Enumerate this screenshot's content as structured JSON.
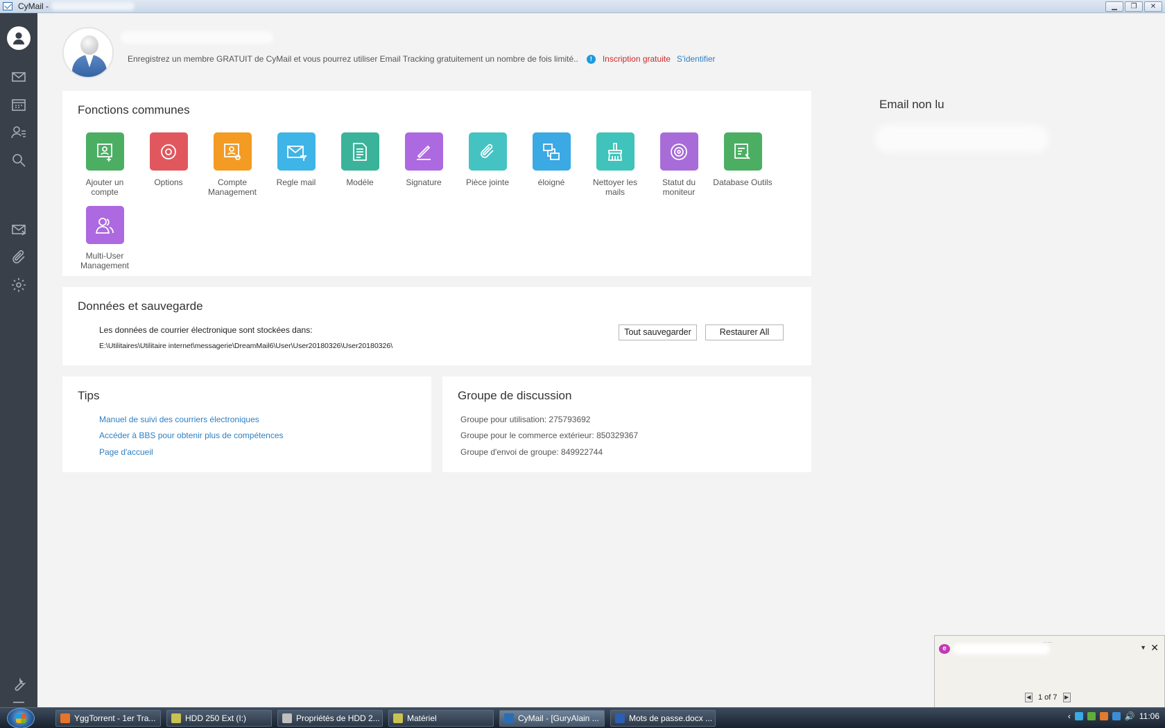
{
  "window": {
    "title": "CyMail - "
  },
  "header": {
    "promo_text": "Enregistrez un membre GRATUIT de CyMail et vous pourrez utiliser Email Tracking gratuitement un nombre de fois limité..",
    "register_link": "Inscription gratuite",
    "login_link": "S'identifier"
  },
  "fonctions": {
    "title": "Fonctions communes",
    "items": [
      {
        "label": "Ajouter un compte",
        "color": "#4cae63",
        "icon": "add-account-icon"
      },
      {
        "label": "Options",
        "color": "#e0585e",
        "icon": "gear-icon"
      },
      {
        "label": "Compte Management",
        "color": "#f39b23",
        "icon": "account-settings-icon"
      },
      {
        "label": "Regle mail",
        "color": "#3fb4e6",
        "icon": "mail-filter-icon"
      },
      {
        "label": "Modéle",
        "color": "#3bb39a",
        "icon": "document-icon"
      },
      {
        "label": "Signature",
        "color": "#ad69df",
        "icon": "pen-icon"
      },
      {
        "label": "Pièce jointe",
        "color": "#45c3c2",
        "icon": "paperclip-icon"
      },
      {
        "label": "éloigné",
        "color": "#3aa9e4",
        "icon": "remote-icon"
      },
      {
        "label": "Nettoyer les mails",
        "color": "#3fc3ba",
        "icon": "broom-icon"
      },
      {
        "label": "Statut du moniteur",
        "color": "#a86cd8",
        "icon": "monitor-target-icon"
      },
      {
        "label": "Database Outils",
        "color": "#4cae63",
        "icon": "database-tool-icon"
      },
      {
        "label": "Multi-User Management",
        "color": "#ad69df",
        "icon": "users-icon"
      }
    ]
  },
  "donnees": {
    "title": "Données et sauvegarde",
    "storage_label": "Les données de courrier électronique sont stockées dans:",
    "storage_path": "E:\\Utilitaires\\Utilitaire internet\\messagerie\\DreamMail6\\User\\User20180326\\User20180326\\",
    "save_all": "Tout sauvegarder",
    "restore_all": "Restaurer All"
  },
  "tips": {
    "title": "Tips",
    "links": [
      "Manuel de suivi des courriers électroniques",
      "Accéder à BBS pour obtenir plus de compétences",
      "Page d'accueil"
    ]
  },
  "groupe": {
    "title": "Groupe de discussion",
    "lines": [
      "Groupe pour utilisation: 275793692",
      "Groupe pour le commerce extérieur: 850329367",
      "Groupe d'envoi de groupe: 849922744"
    ]
  },
  "unread": {
    "title": "Email non lu"
  },
  "notification": {
    "pager": "1 of 7"
  },
  "taskbar": {
    "items": [
      {
        "label": "YggTorrent - 1er Tra...",
        "color": "#e8742a"
      },
      {
        "label": "HDD 250 Ext  (I:)",
        "color": "#c9c253"
      },
      {
        "label": "Propriétés de HDD 2...",
        "color": "#bfbfbf"
      },
      {
        "label": "Matériel",
        "color": "#c9c253"
      },
      {
        "label": "CyMail - [GuryAlain ...",
        "color": "#2a6db3"
      },
      {
        "label": "Mots de passe.docx ...",
        "color": "#2b5fb4"
      }
    ],
    "clock": "11:06"
  }
}
